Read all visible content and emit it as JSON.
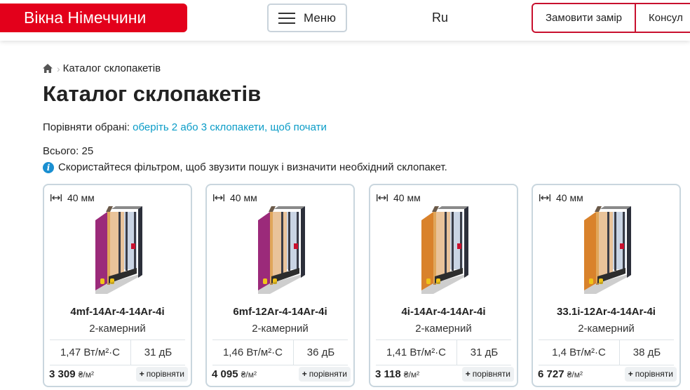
{
  "header": {
    "logo_text": "Вікна Німеччини",
    "menu_label": "Меню",
    "lang": "Ru",
    "cta_order": "Замовити замір",
    "cta_consult": "Консул"
  },
  "breadcrumb": {
    "current": "Каталог склопакетів"
  },
  "page_title": "Каталог склопакетів",
  "compare": {
    "label": "Порівняти обрані:",
    "link": "оберіть 2 або 3 склопакети, щоб почати"
  },
  "total": "Всього: 25",
  "hint": "Скористайтеся фільтром, щоб звузити пошук і визначити необхідний склопакет.",
  "colors": {
    "brand_red": "#e3001b",
    "link_blue": "#0a9cc7",
    "info_blue": "#1a8fd1"
  },
  "cards": [
    {
      "thickness": "40 мм",
      "name": "4mf-14Ar-4-14Ar-4i",
      "chambers": "2-камерний",
      "u_value": "1,47 Вт/м²·С",
      "sound": "31 дБ",
      "price": "3 309",
      "price_unit": "₴/м²",
      "compare_label": "порівняти",
      "outer_pane_color": "#9b2a7a"
    },
    {
      "thickness": "40 мм",
      "name": "6mf-12Ar-4-14Ar-4i",
      "chambers": "2-камерний",
      "u_value": "1,46 Вт/м²·С",
      "sound": "36 дБ",
      "price": "4 095",
      "price_unit": "₴/м²",
      "compare_label": "порівняти",
      "outer_pane_color": "#9b2a7a"
    },
    {
      "thickness": "40 мм",
      "name": "4i-14Ar-4-14Ar-4i",
      "chambers": "2-камерний",
      "u_value": "1,41 Вт/м²·С",
      "sound": "31 дБ",
      "price": "3 118",
      "price_unit": "₴/м²",
      "compare_label": "порівняти",
      "outer_pane_color": "#d9822b"
    },
    {
      "thickness": "40 мм",
      "name": "33.1i-12Ar-4-14Ar-4i",
      "chambers": "2-камерний",
      "u_value": "1,4 Вт/м²·С",
      "sound": "38 дБ",
      "price": "6 727",
      "price_unit": "₴/м²",
      "compare_label": "порівняти",
      "outer_pane_color": "#d9822b"
    }
  ]
}
